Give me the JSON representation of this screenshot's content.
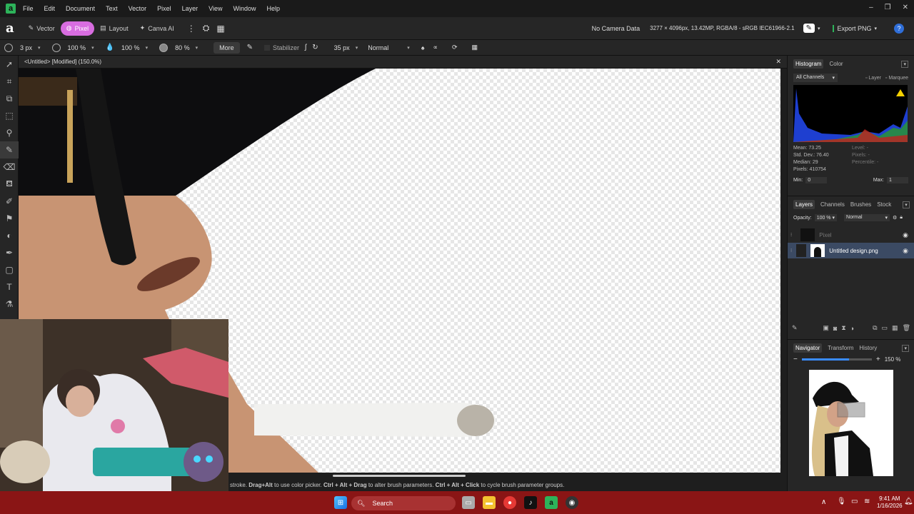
{
  "menu": [
    "File",
    "Edit",
    "Document",
    "Text",
    "Vector",
    "Pixel",
    "Layer",
    "View",
    "Window",
    "Help"
  ],
  "personas": [
    {
      "label": "Vector",
      "active": false
    },
    {
      "label": "Pixel",
      "active": true
    },
    {
      "label": "Layout",
      "active": false
    },
    {
      "label": "Canva AI",
      "active": false
    }
  ],
  "toolbar": {
    "camera": "No Camera Data",
    "docinfo": "3277 × 4096px, 13.42MP, RGBA/8 - sRGB IEC61966-2.1",
    "export": "Export PNG"
  },
  "brush": {
    "width": "3 px",
    "opacity": "100 %",
    "flow": "100 %",
    "hardness": "80 %",
    "more": "More",
    "stabilizer": "Stabilizer",
    "size2": "35 px",
    "blend": "Normal"
  },
  "doc_tab": "<Untitled> [Modified] (150.0%)",
  "status": {
    "pre": "stroke.",
    "k1": "Drag+Alt",
    "t1": "to use color picker.",
    "k2": "Ctrl + Alt + Drag",
    "t2": "to alter brush parameters.",
    "k3": "Ctrl + Alt + Click",
    "t3": "to cycle brush parameter groups."
  },
  "histogram": {
    "tabs": [
      "Histogram",
      "Color"
    ],
    "channels": "All Channels",
    "layer": "Layer",
    "marquee": "Marquee",
    "mean": "Mean: 73.25",
    "std": "Std. Dev.: 76.40",
    "median": "Median: 29",
    "pixels": "Pixels: 410754",
    "level": "Level: -",
    "pixels2": "Pixels: -",
    "percentile": "Percentile: -",
    "min_label": "Min:",
    "min": "0",
    "max_label": "Max:",
    "max": "1"
  },
  "layers": {
    "tabs": [
      "Layers",
      "Channels",
      "Brushes",
      "Stock"
    ],
    "opacity_label": "Opacity:",
    "opacity": "100 %",
    "blend": "Normal",
    "items": [
      {
        "name": "Pixel",
        "selected": false
      },
      {
        "name": "Untitled design.png",
        "selected": true
      }
    ]
  },
  "navigator": {
    "tabs": [
      "Navigator",
      "Transform",
      "History"
    ],
    "zoom": "150 %",
    "zoom_fraction": 0.68
  },
  "taskbar": {
    "search": "Search",
    "time": "9:41 AM",
    "date": "1/16/2026"
  },
  "colors": {
    "accent_persona": "#d86de0",
    "taskbar": "#8a1515",
    "selection": "#3b4a63",
    "brand": "#2db35a"
  }
}
